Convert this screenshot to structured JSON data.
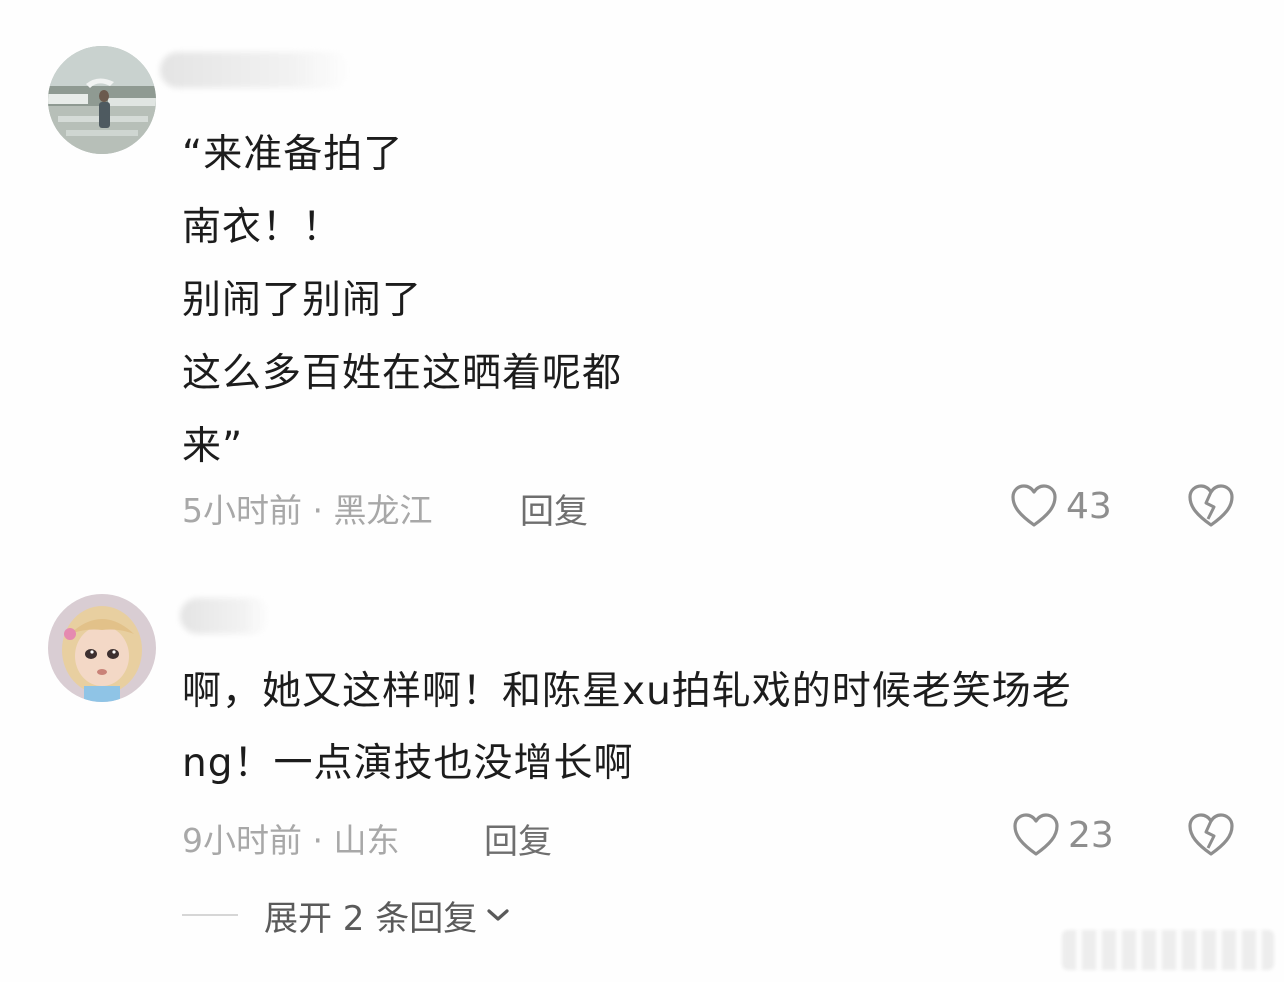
{
  "comments": [
    {
      "avatar_icon": "scenery-photo-avatar",
      "lines": [
        "“来准备拍了",
        "南衣！！",
        "别闹了别闹了",
        "这么多百姓在这晒着呢都",
        "来”"
      ],
      "meta": "5小时前 · 黑龙江",
      "reply_label": "回复",
      "like_count": "43"
    },
    {
      "avatar_icon": "cartoon-girl-avatar",
      "lines": [
        "啊，她又这样啊！和陈星xu拍轧戏的时候老笑场老",
        "ng！一点演技也没增长啊"
      ],
      "meta": "9小时前 · 山东",
      "reply_label": "回复",
      "like_count": "23"
    }
  ],
  "expand": {
    "label": "展开 2 条回复",
    "icon": "chevron-down-icon"
  },
  "colors": {
    "text": "#1c1c1c",
    "meta": "#a8a8a8",
    "reply": "#6e6e6e",
    "icon": "#8e8e8e",
    "background": "#fefefe"
  }
}
